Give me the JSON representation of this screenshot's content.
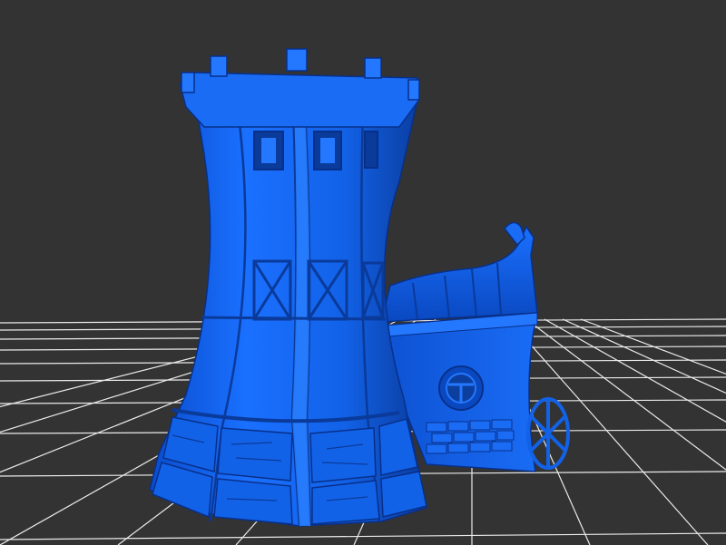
{
  "scene": {
    "background_color": "#333333",
    "grid_color": "#ffffff",
    "model_color": "#1060e0",
    "model_shadow_color": "#0a3a9a",
    "model_highlight_color": "#3a8aff",
    "model": "tower-with-side-house",
    "grid": true
  }
}
